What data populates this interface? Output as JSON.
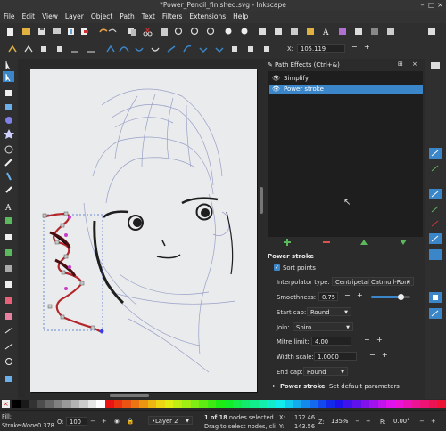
{
  "window": {
    "title": "*Power_Pencil_finished.svg - Inkscape"
  },
  "menu": [
    "File",
    "Edit",
    "View",
    "Layer",
    "Object",
    "Path",
    "Text",
    "Filters",
    "Extensions",
    "Help"
  ],
  "toolctl": {
    "x_label": "X:",
    "x_value": "105.119",
    "minus": "−",
    "plus": "+"
  },
  "dock": {
    "title": "Path Effects (Ctrl+&)",
    "effects": [
      "Simplify",
      "Power stroke"
    ],
    "selected_effect": "Power stroke"
  },
  "powerstroke": {
    "heading": "Power stroke",
    "sort_points_label": "Sort points",
    "sort_points_checked": true,
    "interpolator_label": "Interpolator type:",
    "interpolator_value": "Centripetal Catmull-Rom",
    "smoothness_label": "Smoothness:",
    "smoothness_value": "0.75",
    "smoothness_level": 0.75,
    "start_cap_label": "Start cap:",
    "start_cap_value": "Round",
    "join_label": "Join:",
    "join_value": "Spiro",
    "mitre_label": "Mitre limit:",
    "mitre_value": "4.00",
    "width_scale_label": "Width scale:",
    "width_scale_value": "1.0000",
    "end_cap_label": "End cap:",
    "end_cap_value": "Round",
    "defaults_title": "Power stroke",
    "defaults_text": ": Set default parameters"
  },
  "status": {
    "fill_label": "Fill:",
    "stroke_label": "Stroke:",
    "stroke_value": "None",
    "stroke_width": "0.378",
    "opacity_label": "O:",
    "opacity_value": "100",
    "layer_value": "•Layer 2",
    "message_bold": "1 of 18",
    "message_line1": " nodes selected.",
    "message_line2": "Drag to select nodes, cli",
    "x_label": "X:",
    "x_value": "172.46",
    "y_label": "Y:",
    "y_value": "143.56",
    "zoom_label": "Z:",
    "zoom_value": "135%",
    "rot_label": "R:",
    "rot_value": "0.00°"
  },
  "colors": {
    "accent": "#3b86c9",
    "path_red": "#b3262b",
    "node_magenta": "#c83cc8",
    "sketch": "#9aa0c8"
  }
}
